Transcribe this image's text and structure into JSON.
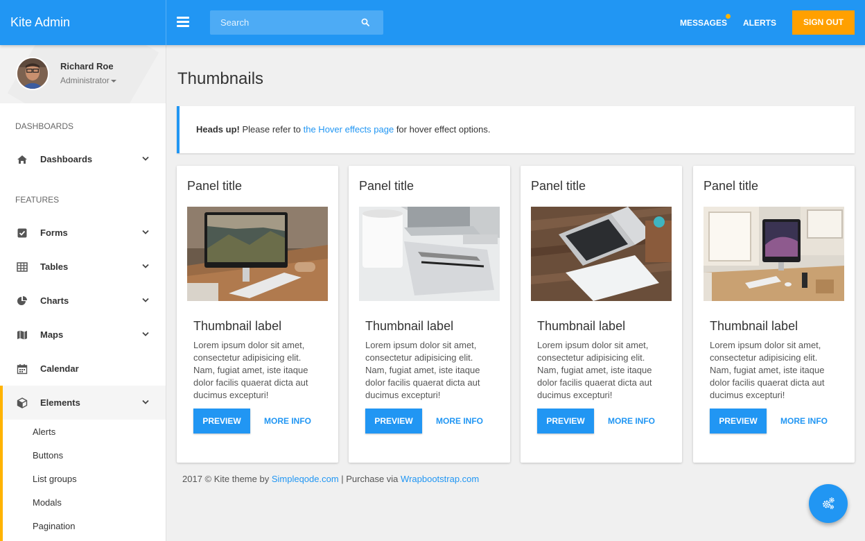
{
  "app": {
    "brand": "Kite Admin"
  },
  "topbar": {
    "search_placeholder": "Search",
    "messages_label": "MESSAGES",
    "alerts_label": "ALERTS",
    "signout_label": "SIGN OUT",
    "accent_color": "#2196f3",
    "signout_color": "#ffa000"
  },
  "user": {
    "name": "Richard Roe",
    "role": "Administrator"
  },
  "sidebar": {
    "section_dashboards": "DASHBOARDS",
    "section_features": "FEATURES",
    "items": [
      {
        "label": "Dashboards",
        "icon": "home-icon"
      },
      {
        "label": "Forms",
        "icon": "checkbox-icon"
      },
      {
        "label": "Tables",
        "icon": "table-icon"
      },
      {
        "label": "Charts",
        "icon": "pie-chart-icon"
      },
      {
        "label": "Maps",
        "icon": "map-icon"
      },
      {
        "label": "Calendar",
        "icon": "calendar-icon"
      },
      {
        "label": "Elements",
        "icon": "cube-icon"
      }
    ],
    "subitems": [
      "Alerts",
      "Buttons",
      "List groups",
      "Modals",
      "Pagination"
    ]
  },
  "page": {
    "title": "Thumbnails",
    "alert": {
      "strong": "Heads up!",
      "before": " Please refer to ",
      "link": "the Hover effects page",
      "after": " for hover effect options."
    }
  },
  "panels": [
    {
      "title": "Panel title",
      "label": "Thumbnail label",
      "text": "Lorem ipsum dolor sit amet, consectetur adipisicing elit. Nam, fugiat amet, iste itaque dolor facilis quaerat dicta aut ducimus excepturi!",
      "preview": "PREVIEW",
      "more": "MORE INFO"
    },
    {
      "title": "Panel title",
      "label": "Thumbnail label",
      "text": "Lorem ipsum dolor sit amet, consectetur adipisicing elit. Nam, fugiat amet, iste itaque dolor facilis quaerat dicta aut ducimus excepturi!",
      "preview": "PREVIEW",
      "more": "MORE INFO"
    },
    {
      "title": "Panel title",
      "label": "Thumbnail label",
      "text": "Lorem ipsum dolor sit amet, consectetur adipisicing elit. Nam, fugiat amet, iste itaque dolor facilis quaerat dicta aut ducimus excepturi!",
      "preview": "PREVIEW",
      "more": "MORE INFO"
    },
    {
      "title": "Panel title",
      "label": "Thumbnail label",
      "text": "Lorem ipsum dolor sit amet, consectetur adipisicing elit. Nam, fugiat amet, iste itaque dolor facilis quaerat dicta aut ducimus excepturi!",
      "preview": "PREVIEW",
      "more": "MORE INFO"
    }
  ],
  "footer": {
    "prefix": "2017 © Kite theme by ",
    "link1": "Simpleqode.com",
    "middle": " | Purchase via ",
    "link2": "Wrapbootstrap.com"
  }
}
